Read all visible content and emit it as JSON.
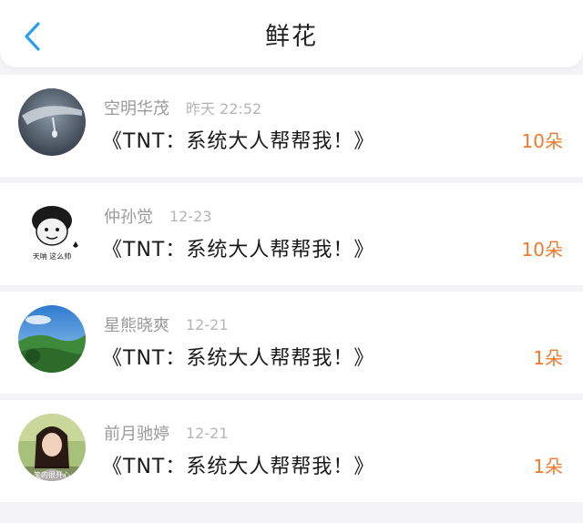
{
  "header": {
    "back_icon": "chevron-left-icon",
    "title": "鲜花"
  },
  "colors": {
    "accent_back": "#2aa0ec",
    "count": "#ee7a2b",
    "name": "#9a9a9a",
    "time": "#b5b5b5"
  },
  "records": [
    {
      "avatar": "avatar-dark-photo",
      "name": "空明华茂",
      "time": "昨天 22:52",
      "book": "《TNT：系统大人帮帮我！》",
      "count": "10朵"
    },
    {
      "avatar": "avatar-meme-cartoon",
      "avatar_caption": "天呐 这么帅",
      "name": "仲孙觉",
      "time": "12-23",
      "book": "《TNT：系统大人帮帮我！》",
      "count": "10朵"
    },
    {
      "avatar": "avatar-landscape-photo",
      "name": "星熊晓爽",
      "time": "12-21",
      "book": "《TNT：系统大人帮帮我！》",
      "count": "1朵"
    },
    {
      "avatar": "avatar-girl-photo",
      "avatar_caption": "笑的很开心",
      "name": "前月驰婷",
      "time": "12-21",
      "book": "《TNT：系统大人帮帮我！》",
      "count": "1朵"
    }
  ]
}
